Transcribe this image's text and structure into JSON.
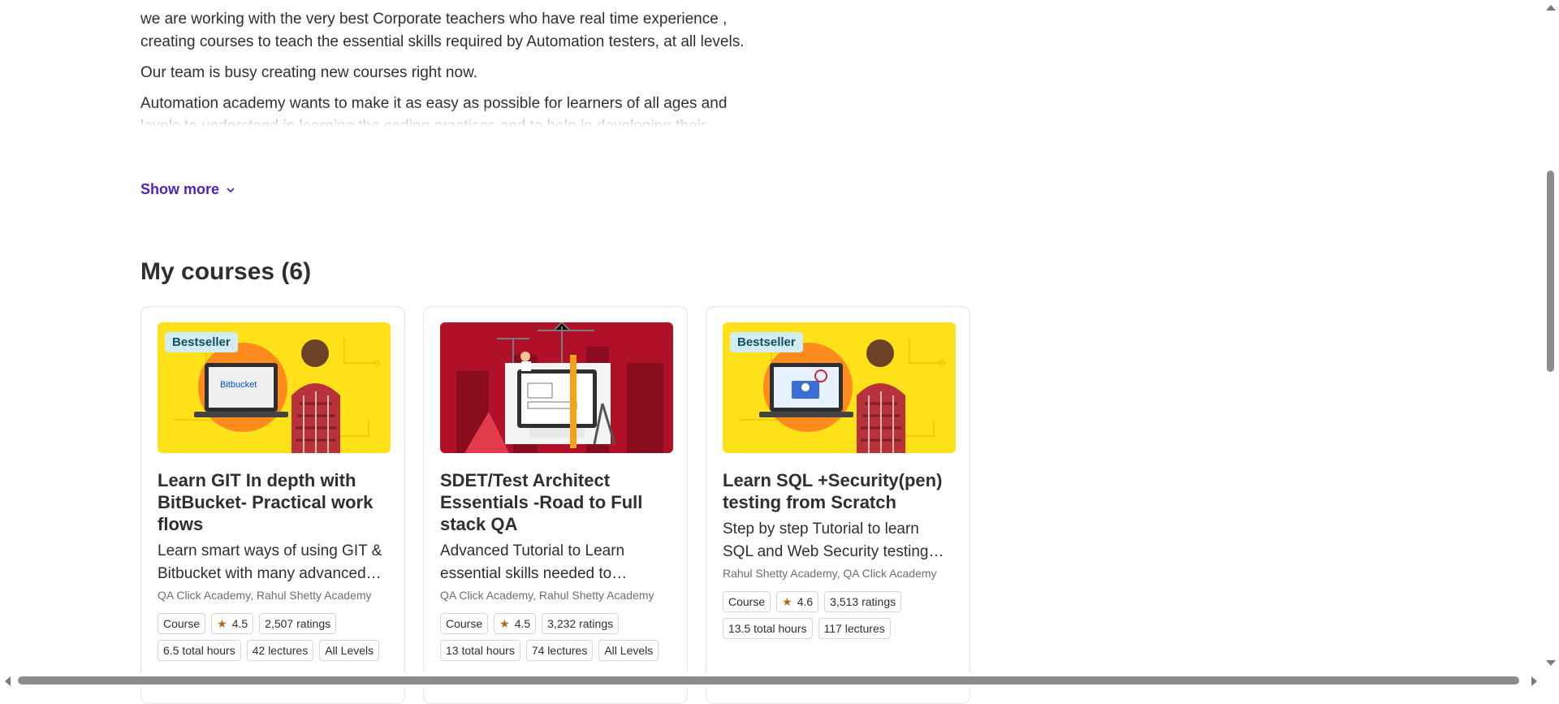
{
  "about": {
    "paragraphs": [
      "we are working with the very best Corporate teachers who have real time experience , creating courses to teach the essential skills required by Automation testers, at all levels.",
      "Our team is busy creating new courses right now.",
      "Automation academy wants to make it as easy as possible for learners of all ages and levels to understand in learning the coding practices and to help in developing their Scripting knowledge for any Test Automation"
    ],
    "show_more": "Show more"
  },
  "section": {
    "title": "My courses (6)"
  },
  "courses": [
    {
      "badge": "Bestseller",
      "thumb_text": "Bitbucket",
      "title": "Learn GIT In depth with BitBucket- Practical work flows",
      "description": "Learn smart ways of using GIT & Bitbucket with many advanced concepts",
      "authors": "QA Click Academy, Rahul Shetty Academy",
      "type": "Course",
      "rating": "4.5",
      "ratings": "2,507 ratings",
      "hours": "6.5 total hours",
      "lectures": "42 lectures",
      "level": "All Levels"
    },
    {
      "badge": "",
      "thumb_text": "",
      "title": "SDET/Test Architect Essentials -Road to Full stack QA",
      "description": "Advanced Tutorial to Learn essential skills needed to become a Full stack QA",
      "authors": "QA Click Academy, Rahul Shetty Academy",
      "type": "Course",
      "rating": "4.5",
      "ratings": "3,232 ratings",
      "hours": "13 total hours",
      "lectures": "74 lectures",
      "level": "All Levels"
    },
    {
      "badge": "Bestseller",
      "thumb_text": "",
      "title": "Learn SQL +Security(pen) testing from Scratch",
      "description": "Step by step Tutorial to learn SQL and Web Security testing from scratch",
      "authors": "Rahul Shetty Academy, QA Click Academy",
      "type": "Course",
      "rating": "4.6",
      "ratings": "3,513 ratings",
      "hours": "13.5 total hours",
      "lectures": "117 lectures",
      "level": ""
    }
  ],
  "icons": {
    "chevron": "chevron-down-icon",
    "star": "star-icon"
  },
  "colors": {
    "accent": "#5022c3",
    "badge_bg": "#d2ecf1",
    "star": "#b4690e",
    "thumb_yellow": "#ffe11a",
    "thumb_red": "#b01028"
  }
}
